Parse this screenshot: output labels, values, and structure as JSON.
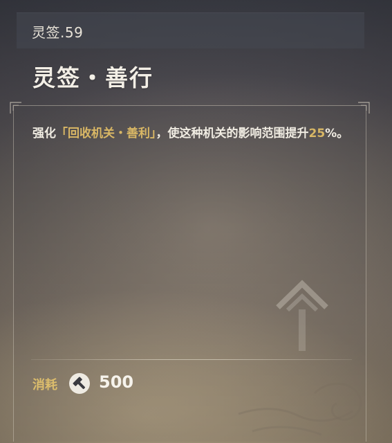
{
  "header": {
    "tag": "灵签.59"
  },
  "card": {
    "title": "灵签・善行",
    "description": {
      "p1": "强化",
      "p2": "「回收机关・善利」",
      "p3": "，使这种机关的影响范围提升",
      "p4": "25",
      "p5": "%。"
    }
  },
  "cost": {
    "label": "消耗",
    "icon": "hammer-icon",
    "value": "500"
  },
  "colors": {
    "highlight": "#d9b765",
    "cost_label": "#dcbd6c",
    "text": "#f0ece2"
  }
}
